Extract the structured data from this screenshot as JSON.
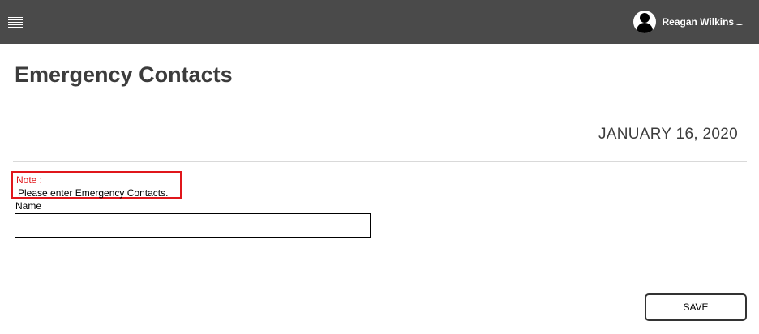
{
  "header": {
    "menu_icon": "hamburger-icon",
    "avatar_icon": "user-avatar-icon",
    "user_name": "Reagan Wilkins",
    "dropdown_icon": "chevron-down-icon",
    "dropdown_glyph": "⌣",
    "background_color": "#4a4a4a"
  },
  "page": {
    "title": "Emergency Contacts",
    "date": "JANUARY 16, 2020"
  },
  "note": {
    "label": "Note :",
    "text": "Please enter Emergency Contacts.",
    "highlight_color": "#e0161b"
  },
  "form": {
    "name_label": "Name",
    "name_value": "",
    "save_label": "SAVE"
  }
}
